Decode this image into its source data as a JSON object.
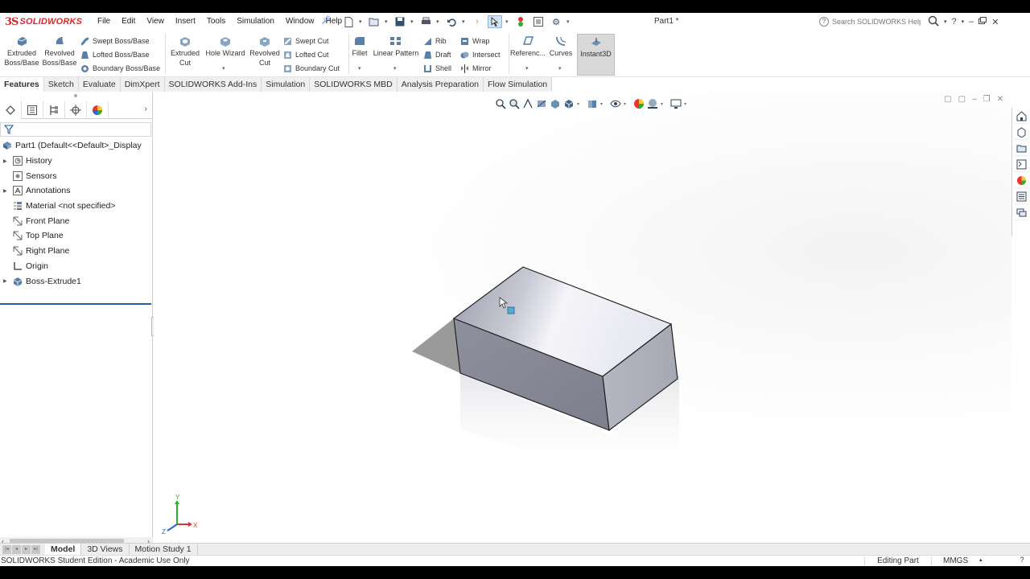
{
  "app": {
    "logo_prefix": "3S",
    "logo_text": "SOLIDWORKS",
    "document_title": "Part1 *"
  },
  "menu": [
    "File",
    "Edit",
    "View",
    "Insert",
    "Tools",
    "Simulation",
    "Window",
    "Help"
  ],
  "search": {
    "placeholder": "Search SOLIDWORKS Help"
  },
  "commands": {
    "extruded_boss": "Extruded Boss/Base",
    "revolved_boss": "Revolved Boss/Base",
    "swept_boss": "Swept Boss/Base",
    "lofted_boss": "Lofted Boss/Base",
    "boundary_boss": "Boundary Boss/Base",
    "extruded_cut": "Extruded Cut",
    "hole_wizard": "Hole Wizard",
    "revolved_cut": "Revolved Cut",
    "swept_cut": "Swept Cut",
    "lofted_cut": "Lofted Cut",
    "boundary_cut": "Boundary Cut",
    "fillet": "Fillet",
    "linear_pattern": "Linear Pattern",
    "rib": "Rib",
    "draft": "Draft",
    "shell": "Shell",
    "wrap": "Wrap",
    "intersect": "Intersect",
    "mirror": "Mirror",
    "reference": "Referenc...",
    "curves": "Curves",
    "instant3d": "Instant3D"
  },
  "tabs": [
    "Features",
    "Sketch",
    "Evaluate",
    "DimXpert",
    "SOLIDWORKS Add-Ins",
    "Simulation",
    "SOLIDWORKS MBD",
    "Analysis Preparation",
    "Flow Simulation"
  ],
  "tree": {
    "root": "Part1  (Default<<Default>_Display",
    "items": [
      "History",
      "Sensors",
      "Annotations",
      "Material <not specified>",
      "Front Plane",
      "Top Plane",
      "Right Plane",
      "Origin",
      "Boss-Extrude1"
    ]
  },
  "bottom_tabs": [
    "Model",
    "3D Views",
    "Motion Study 1"
  ],
  "status": {
    "edition": "SOLIDWORKS Student Edition - Academic Use Only",
    "mode": "Editing Part",
    "units": "MMGS"
  },
  "colors": {
    "brand_red": "#d8262e",
    "selection_blue": "#1f5fa8",
    "model_face": "#8a8c98"
  }
}
